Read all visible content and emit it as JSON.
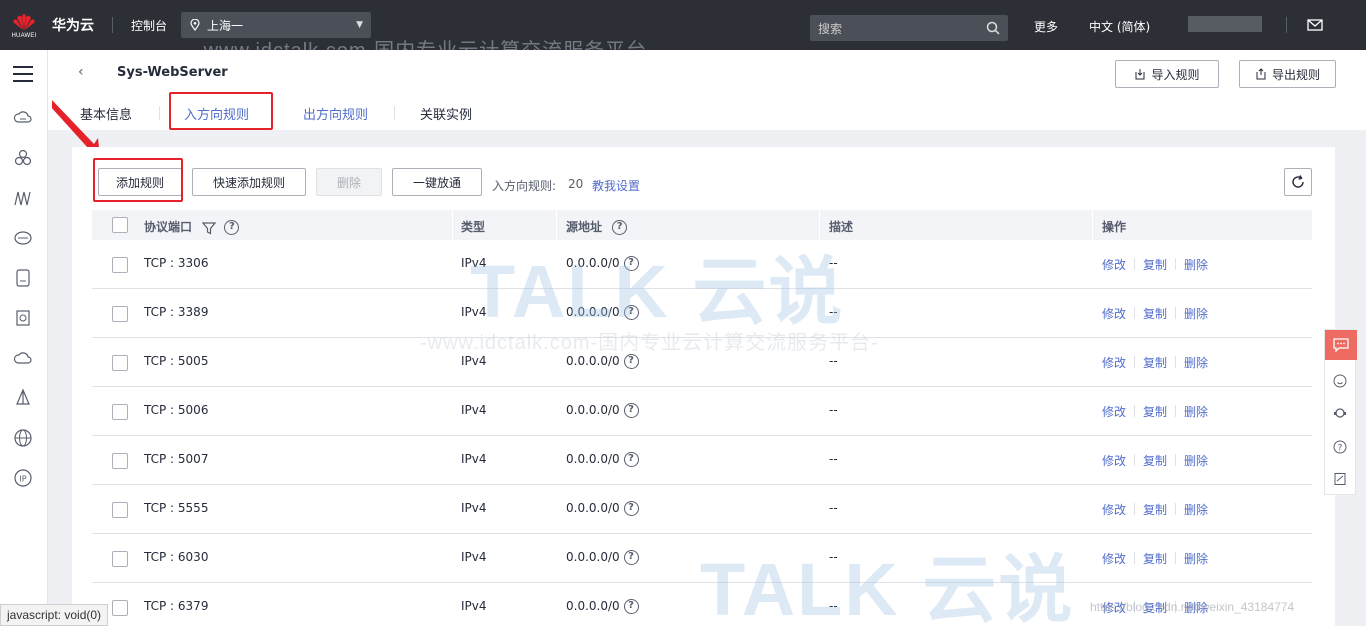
{
  "topbar": {
    "logo_text": "HUAWEI",
    "brand": "华为云",
    "console": "控制台",
    "region": "上海一",
    "search_placeholder": "搜索",
    "more": "更多",
    "language": "中文 (简体)"
  },
  "header": {
    "back": "‹",
    "title": "Sys-WebServer",
    "import_label": "导入规则",
    "export_label": "导出规则",
    "tabs": [
      "基本信息",
      "入方向规则",
      "出方向规则",
      "关联实例"
    ]
  },
  "toolbar": {
    "add_rule": "添加规则",
    "quick_add": "快速添加规则",
    "delete": "删除",
    "allow_all": "一键放通",
    "count_label": "入方向规则:",
    "count_value": "20",
    "help_link": "教我设置"
  },
  "table": {
    "columns": [
      "协议端口",
      "类型",
      "源地址",
      "描述",
      "操作"
    ],
    "rows": [
      {
        "port": "TCP : 3306",
        "type": "IPv4",
        "source": "0.0.0.0/0",
        "desc": "--"
      },
      {
        "port": "TCP : 3389",
        "type": "IPv4",
        "source": "0.0.0.0/0",
        "desc": "--"
      },
      {
        "port": "TCP : 5005",
        "type": "IPv4",
        "source": "0.0.0.0/0",
        "desc": "--"
      },
      {
        "port": "TCP : 5006",
        "type": "IPv4",
        "source": "0.0.0.0/0",
        "desc": "--"
      },
      {
        "port": "TCP : 5007",
        "type": "IPv4",
        "source": "0.0.0.0/0",
        "desc": "--"
      },
      {
        "port": "TCP : 5555",
        "type": "IPv4",
        "source": "0.0.0.0/0",
        "desc": "--"
      },
      {
        "port": "TCP : 6030",
        "type": "IPv4",
        "source": "0.0.0.0/0",
        "desc": "--"
      },
      {
        "port": "TCP : 6379",
        "type": "IPv4",
        "source": "0.0.0.0/0",
        "desc": "--"
      }
    ],
    "actions": {
      "edit": "修改",
      "copy": "复制",
      "delete": "删除"
    }
  },
  "status_bar": "javascript: void(0)",
  "watermarks": {
    "url_text": "-www.idctalk.com-国内专业云计算交流服务平台-",
    "brand_text": "TALK 云说",
    "corner_text": "https://blog.csdn.net/weixin_43184774"
  },
  "colors": {
    "topbar": "#2c2f35",
    "link": "#526ecc",
    "highlight": "#e5212a",
    "float_accent": "#ee6b61"
  }
}
